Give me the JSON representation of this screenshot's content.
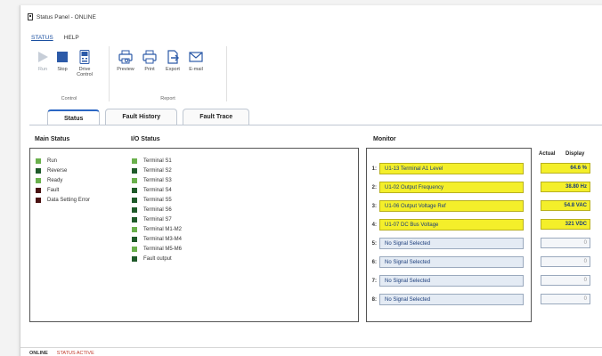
{
  "window": {
    "title": "Status Panel - ONLINE"
  },
  "menu": {
    "items": [
      "STATUS",
      "HELP"
    ]
  },
  "ribbon": {
    "control": {
      "label": "Control",
      "buttons": [
        "Run",
        "Stop",
        "Drive Control"
      ]
    },
    "report": {
      "label": "Report",
      "buttons": [
        "Preview",
        "Print",
        "Export",
        "E-mail"
      ]
    }
  },
  "tabs": [
    "Status",
    "Fault History",
    "Fault Trace"
  ],
  "main_status": {
    "title": "Main Status",
    "items": [
      {
        "label": "Run",
        "color": "#6ab04c"
      },
      {
        "label": "Reverse",
        "color": "#1f5a2a"
      },
      {
        "label": "Ready",
        "color": "#6ab04c"
      },
      {
        "label": "Fault",
        "color": "#4a1212"
      },
      {
        "label": "Data Setting Error",
        "color": "#4a1212"
      }
    ]
  },
  "io_status": {
    "title": "I/O Status",
    "items": [
      {
        "label": "Terminal S1",
        "color": "#6ab04c"
      },
      {
        "label": "Terminal S2",
        "color": "#1f5a2a"
      },
      {
        "label": "Terminal S3",
        "color": "#6ab04c"
      },
      {
        "label": "Terminal S4",
        "color": "#1f5a2a"
      },
      {
        "label": "Terminal S5",
        "color": "#1f5a2a"
      },
      {
        "label": "Terminal S6",
        "color": "#1f5a2a"
      },
      {
        "label": "Terminal S7",
        "color": "#1f5a2a"
      },
      {
        "label": "Terminal M1-M2",
        "color": "#6ab04c"
      },
      {
        "label": "Terminal M3-M4",
        "color": "#1f5a2a"
      },
      {
        "label": "Terminal M5-M6",
        "color": "#6ab04c"
      },
      {
        "label": "Fault output",
        "color": "#1f5a2a"
      }
    ]
  },
  "monitor": {
    "title": "Monitor",
    "actual_label": "Actual",
    "display_label": "Display",
    "rows": [
      {
        "num": "1:",
        "label": "U1-13 Terminal A1 Level",
        "value": "64.6 %",
        "active": true
      },
      {
        "num": "2:",
        "label": "U1-02 Output Frequency",
        "value": "38.80 Hz",
        "active": true
      },
      {
        "num": "3:",
        "label": "U1-06 Output Voltage Ref",
        "value": "54.8 VAC",
        "active": true
      },
      {
        "num": "4:",
        "label": "U1-07 DC Bus Voltage",
        "value": "321 VDC",
        "active": true
      },
      {
        "num": "5:",
        "label": "No Signal Selected",
        "value": "0",
        "active": false
      },
      {
        "num": "6:",
        "label": "No Signal Selected",
        "value": "0",
        "active": false
      },
      {
        "num": "7:",
        "label": "No Signal Selected",
        "value": "0",
        "active": false
      },
      {
        "num": "8:",
        "label": "No Signal Selected",
        "value": "0",
        "active": false
      }
    ]
  },
  "statusbar": {
    "online": "ONLINE",
    "status": "STATUS ACTIVE"
  }
}
